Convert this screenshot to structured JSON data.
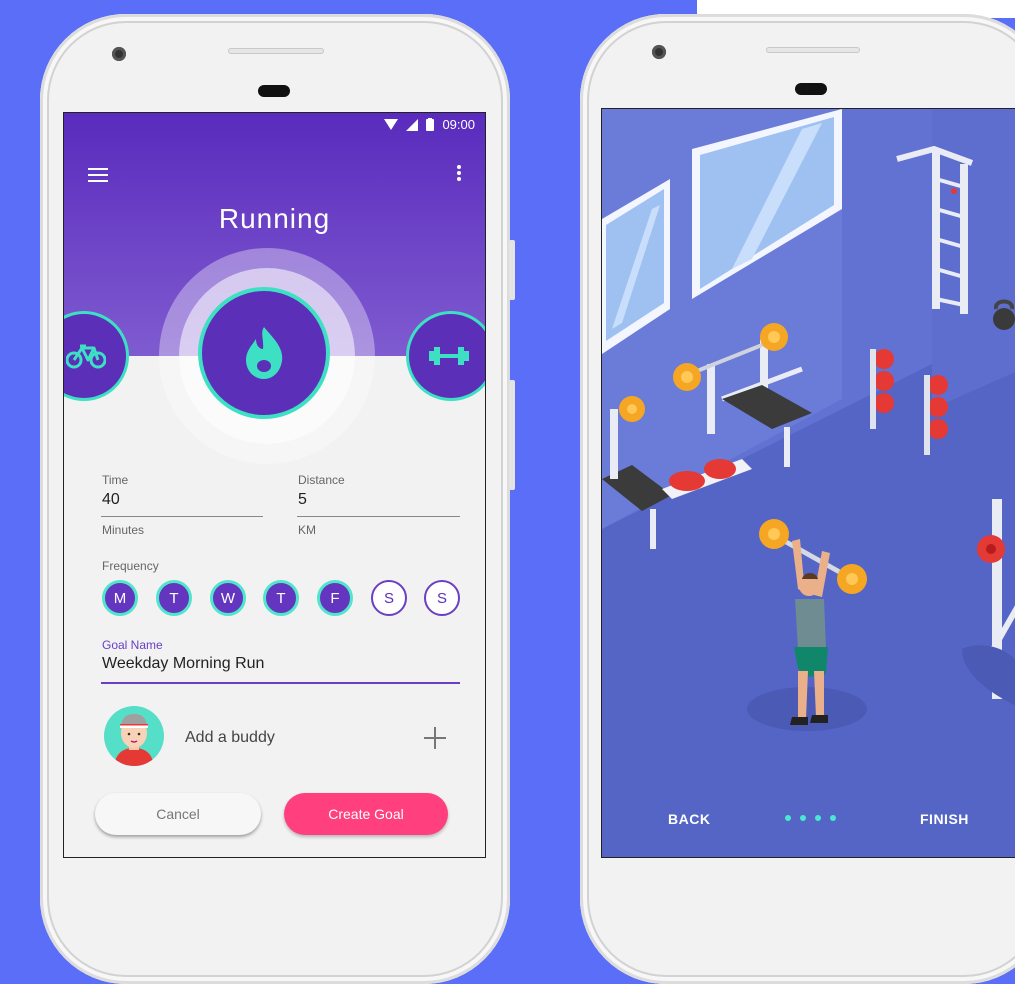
{
  "colors": {
    "background": "#5b6ef7",
    "hero_top": "#5a2bbd",
    "hero_bottom": "#7f5bd0",
    "accent_teal": "#3ee0c4",
    "primary_purple": "#5b2fb8",
    "create_button": "#ff3f7e",
    "illustration_floor": "#5567c7"
  },
  "phone1": {
    "status_bar": {
      "time": "09:00",
      "icons": [
        "wifi-icon",
        "signal-icon",
        "battery-icon"
      ]
    },
    "toolbar": {
      "menu_icon": "hamburger-menu-icon",
      "overflow_icon": "more-vert-icon"
    },
    "title": "Running",
    "activities": [
      {
        "icon": "bicycle-icon"
      },
      {
        "icon": "flame-icon",
        "selected": true
      },
      {
        "icon": "dumbbell-icon"
      }
    ],
    "time_field": {
      "label": "Time",
      "value": "40",
      "unit": "Minutes"
    },
    "distance_field": {
      "label": "Distance",
      "value": "5",
      "unit": "KM"
    },
    "frequency": {
      "label": "Frequency",
      "days": [
        "M",
        "T",
        "W",
        "T",
        "F",
        "S",
        "S"
      ],
      "selected": [
        true,
        true,
        true,
        true,
        true,
        false,
        false
      ]
    },
    "goal_name": {
      "label": "Goal Name",
      "value": "Weekday Morning Run"
    },
    "buddy": {
      "label": "Add a buddy",
      "add_icon": "plus-icon"
    },
    "buttons": {
      "cancel": "Cancel",
      "create": "Create Goal"
    }
  },
  "phone2": {
    "illustration": "gym-weightlifter-illustration",
    "nav": {
      "back": "BACK",
      "finish": "FINISH",
      "page_dots": 4
    }
  }
}
